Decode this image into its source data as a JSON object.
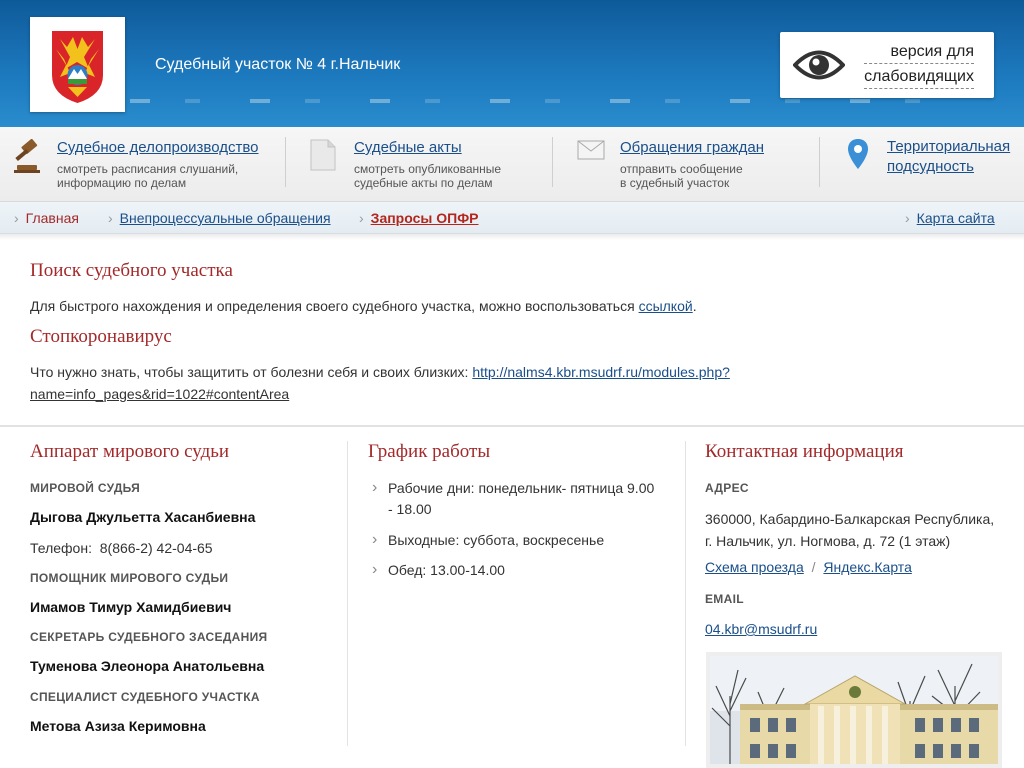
{
  "header": {
    "site_title": "Судебный участок № 4 г.Нальчик",
    "vision_line1": "версия для",
    "vision_line2": "слабовидящих"
  },
  "topnav": [
    {
      "title": "Судебное делопроизводство",
      "sub1": "смотреть расписания слушаний,",
      "sub2": "информацию по делам",
      "icon": "gavel-icon"
    },
    {
      "title": "Судебные акты",
      "sub1": "смотреть опубликованные",
      "sub2": "судебные акты по делам",
      "icon": "document-icon"
    },
    {
      "title": "Обращения граждан",
      "sub1": "отправить сообщение",
      "sub2": "в судебный участок",
      "icon": "envelope-icon"
    },
    {
      "title1": "Территориальная",
      "title2": "подсудность",
      "icon": "map-pin-icon"
    }
  ],
  "breadcrumb": {
    "home": "Главная",
    "mid": "Внепроцессуальные обращения",
    "current": "Запросы ОПФР",
    "sitemap": "Карта сайта"
  },
  "search": {
    "heading": "Поиск судебного участка",
    "text": "Для быстрого нахождения и определения  своего судебного участка, можно воспользоваться",
    "link": "ссылкой",
    "after": "."
  },
  "covid": {
    "heading": "Стопкоронавирус",
    "text": "Что нужно знать, чтобы защитить от болезни себя и своих близких:",
    "link1": " http://nalms4.kbr.msudrf.ru/modules.php?",
    "link2": "name=info_pages&rid=1022#contentArea"
  },
  "staff": {
    "heading": "Аппарат мирового судьи",
    "judge_label": "МИРОВОЙ СУДЬЯ",
    "judge_name": "Дыгова Джульетта Хасанбиевна",
    "phone_label": "Телефон:",
    "phone": "8(866-2) 42-04-65",
    "assistant_label": "ПОМОЩНИК МИРОВОГО СУДЬИ",
    "assistant_name": "Имамов Тимур Хамидбиевич",
    "secretary_label": "СЕКРЕТАРЬ СУДЕБНОГО ЗАСЕДАНИЯ",
    "secretary_name": "Туменова Элеонора Анатольевна",
    "specialist_label": "СПЕЦИАЛИСТ СУДЕБНОГО УЧАСТКА",
    "specialist_name": "Метова Азиза Керимовна"
  },
  "schedule": {
    "heading": "График работы",
    "items": [
      {
        "line1": "Рабочие дни: понедельник- пятница 9.00",
        "line2": "- 18.00"
      },
      {
        "line1": "Выходные: суббота, воскресенье"
      },
      {
        "line1": "Обед: 13.00-14.00"
      }
    ]
  },
  "contacts": {
    "heading": "Контактная информация",
    "address_label": "АДРЕС",
    "address1": "360000, Кабардино-Балкарская Республика,",
    "address2": "г. Нальчик, ул. Ногмова, д. 72 (1 этаж)",
    "map_link1": "Схема проезда",
    "map_sep": "/",
    "map_link2": "Яндекс.Карта",
    "email_label": "EMAIL",
    "email": "04.kbr@msudrf.ru"
  },
  "colors": {
    "header_blue": "#1a72b6",
    "heading_red": "#a3292a",
    "link_blue": "#1a4f8a"
  }
}
